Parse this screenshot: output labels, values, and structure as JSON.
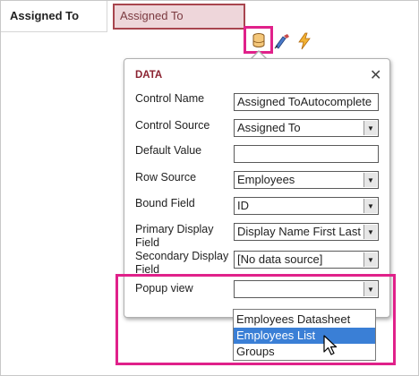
{
  "field_row": {
    "label": "Assigned To",
    "control_text": "Assigned To"
  },
  "toolbar": {
    "icons": [
      "data-icon",
      "formatting-icon",
      "actions-icon"
    ],
    "selected": "data-icon"
  },
  "popup": {
    "title": "DATA",
    "close": "✕",
    "properties": [
      {
        "label": "Control Name",
        "value": "Assigned ToAutocomplete",
        "kind": "text"
      },
      {
        "label": "Control Source",
        "value": "Assigned To",
        "kind": "select"
      },
      {
        "label": "Default Value",
        "value": "",
        "kind": "text"
      },
      {
        "label": "Row Source",
        "value": "Employees",
        "kind": "select"
      },
      {
        "label": "Bound Field",
        "value": "ID",
        "kind": "select"
      },
      {
        "label": "Primary Display Field",
        "value": "Display Name First Last",
        "kind": "select"
      },
      {
        "label": "Secondary Display Field",
        "value": "[No data source]",
        "kind": "select"
      },
      {
        "label": "Popup view",
        "value": "",
        "kind": "select"
      }
    ]
  },
  "dropdown": {
    "options": [
      "Employees Datasheet",
      "Employees List",
      "Groups"
    ],
    "selected_index": 1
  },
  "colors": {
    "highlight": "#e0218a",
    "title": "#8b2331",
    "selection": "#3a7fd6",
    "field_fill": "#eed6da",
    "field_border": "#a8454e"
  }
}
